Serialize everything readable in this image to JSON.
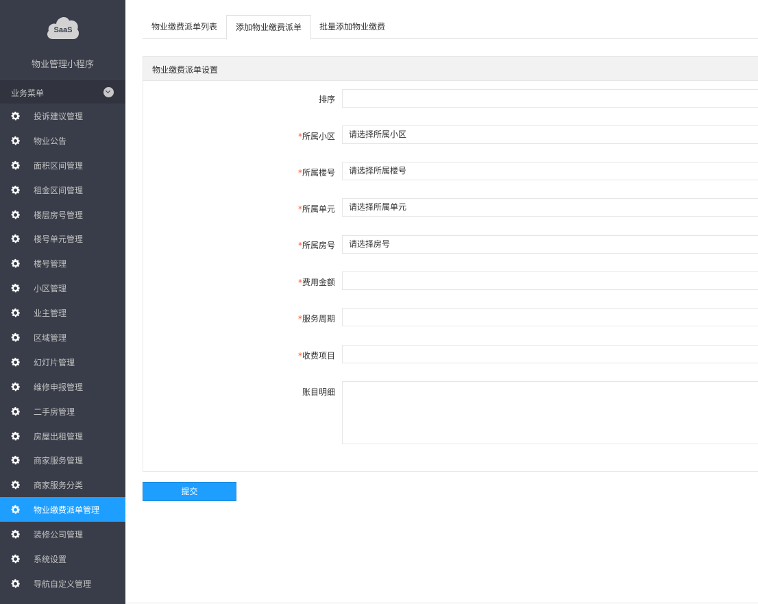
{
  "app": {
    "logo_text": "SaaS",
    "name": "物业管理小程序"
  },
  "sidebar": {
    "section_label": "业务菜单",
    "items": [
      {
        "label": "投诉建议管理",
        "active": false
      },
      {
        "label": "物业公告",
        "active": false
      },
      {
        "label": "面积区间管理",
        "active": false
      },
      {
        "label": "租金区间管理",
        "active": false
      },
      {
        "label": "楼层房号管理",
        "active": false
      },
      {
        "label": "楼号单元管理",
        "active": false
      },
      {
        "label": "楼号管理",
        "active": false
      },
      {
        "label": "小区管理",
        "active": false
      },
      {
        "label": "业主管理",
        "active": false
      },
      {
        "label": "区域管理",
        "active": false
      },
      {
        "label": "幻灯片管理",
        "active": false
      },
      {
        "label": "维修申报管理",
        "active": false
      },
      {
        "label": "二手房管理",
        "active": false
      },
      {
        "label": "房屋出租管理",
        "active": false
      },
      {
        "label": "商家服务管理",
        "active": false
      },
      {
        "label": "商家服务分类",
        "active": false
      },
      {
        "label": "物业缴费派单管理",
        "active": true
      },
      {
        "label": "装修公司管理",
        "active": false
      },
      {
        "label": "系统设置",
        "active": false
      },
      {
        "label": "导航自定义管理",
        "active": false
      }
    ]
  },
  "tabs": [
    {
      "label": "物业缴费派单列表"
    },
    {
      "label": "添加物业缴费派单"
    },
    {
      "label": "批量添加物业缴费"
    }
  ],
  "panel": {
    "title": "物业缴费派单设置",
    "fields": [
      {
        "label": "排序",
        "required": false,
        "value": ""
      },
      {
        "label": "所属小区",
        "required": true,
        "value": "请选择所属小区"
      },
      {
        "label": "所属楼号",
        "required": true,
        "value": "请选择所属楼号"
      },
      {
        "label": "所属单元",
        "required": true,
        "value": "请选择所属单元"
      },
      {
        "label": "所属房号",
        "required": true,
        "value": "请选择房号"
      },
      {
        "label": "费用金额",
        "required": true,
        "value": ""
      },
      {
        "label": "服务周期",
        "required": true,
        "value": ""
      },
      {
        "label": "收费项目",
        "required": true,
        "value": ""
      }
    ],
    "textarea_label": "账目明细",
    "required_mark": "*"
  },
  "submit_label": "提交",
  "colors": {
    "sidebar_bg": "#393d49",
    "accent": "#1e9fff",
    "required": "#ff5722"
  },
  "icons": {
    "menu_item": "gear-icon",
    "section_toggle": "chevron-down-icon",
    "logo": "cloud-icon"
  }
}
